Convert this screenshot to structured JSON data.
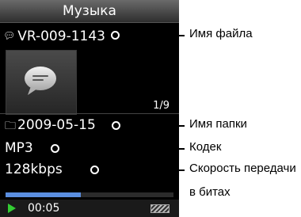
{
  "header": {
    "title": "Музыка"
  },
  "file": {
    "icon": "speech-bubble-icon",
    "name": "VR-009-1143"
  },
  "album_art": {
    "icon": "speech-bubble-icon"
  },
  "track_counter": "1/9",
  "folder": {
    "icon": "folder-icon",
    "name": "2009-05-15"
  },
  "codec": "MP3",
  "bitrate": "128kbps",
  "playback": {
    "progress_fraction": 0.45,
    "elapsed": "00:05",
    "state_icon": "play-icon"
  },
  "battery": {
    "icon": "battery-icon"
  },
  "callouts": {
    "file_name": "Имя файла",
    "folder_name": "Имя папки",
    "codec": "Кодек",
    "bitrate_line1": "Скорость передачи",
    "bitrate_line2": "в битах"
  },
  "colors": {
    "progress": "#5a8ee0",
    "play": "#33cc33",
    "screen": "#000000",
    "accent_text": "#ffffff"
  }
}
